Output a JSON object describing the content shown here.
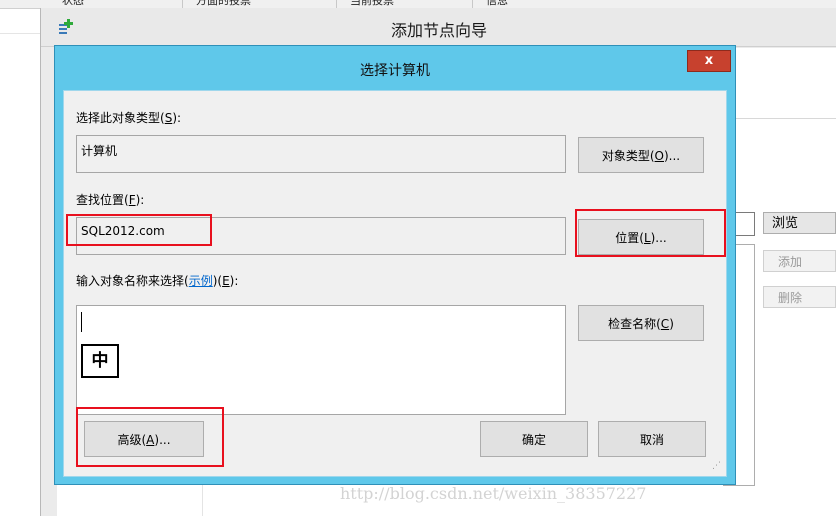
{
  "background_table": {
    "columns": [
      "状态",
      "方面的投票",
      "当前投票",
      "信息"
    ]
  },
  "wizard": {
    "title": "添加节点向导",
    "browse_label": "浏览",
    "add_label": "添加",
    "delete_label": "删除"
  },
  "dialog": {
    "title": "选择计算机",
    "close_label": "x",
    "object_type_label": "选择此对象类型(",
    "object_type_key": "S",
    "object_type_label_end": "):",
    "object_type_value": "计算机",
    "object_type_button": "对象类型(",
    "object_type_button_key": "O",
    "object_type_button_end": ")...",
    "location_label": "查找位置(",
    "location_key": "F",
    "location_label_end": "):",
    "location_value": "SQL2012.com",
    "location_button": "位置(",
    "location_button_key": "L",
    "location_button_end": ")...",
    "names_label": "输入对象名称来选择(",
    "names_link": "示例",
    "names_label_mid": ")(",
    "names_key": "E",
    "names_label_end": "):",
    "names_value": "",
    "ime_indicator": "中",
    "check_names_button": "检查名称(",
    "check_names_key": "C",
    "check_names_end": ")",
    "advanced_button": "高级(",
    "advanced_key": "A",
    "advanced_end": ")...",
    "ok_button": "确定",
    "cancel_button": "取消"
  },
  "watermark": "http://blog.csdn.net/weixin_38357227",
  "colors": {
    "dialog_frame": "#5fc8ea",
    "close_button": "#c7412e",
    "highlight_red": "#e8101e",
    "link": "#0066cc"
  }
}
